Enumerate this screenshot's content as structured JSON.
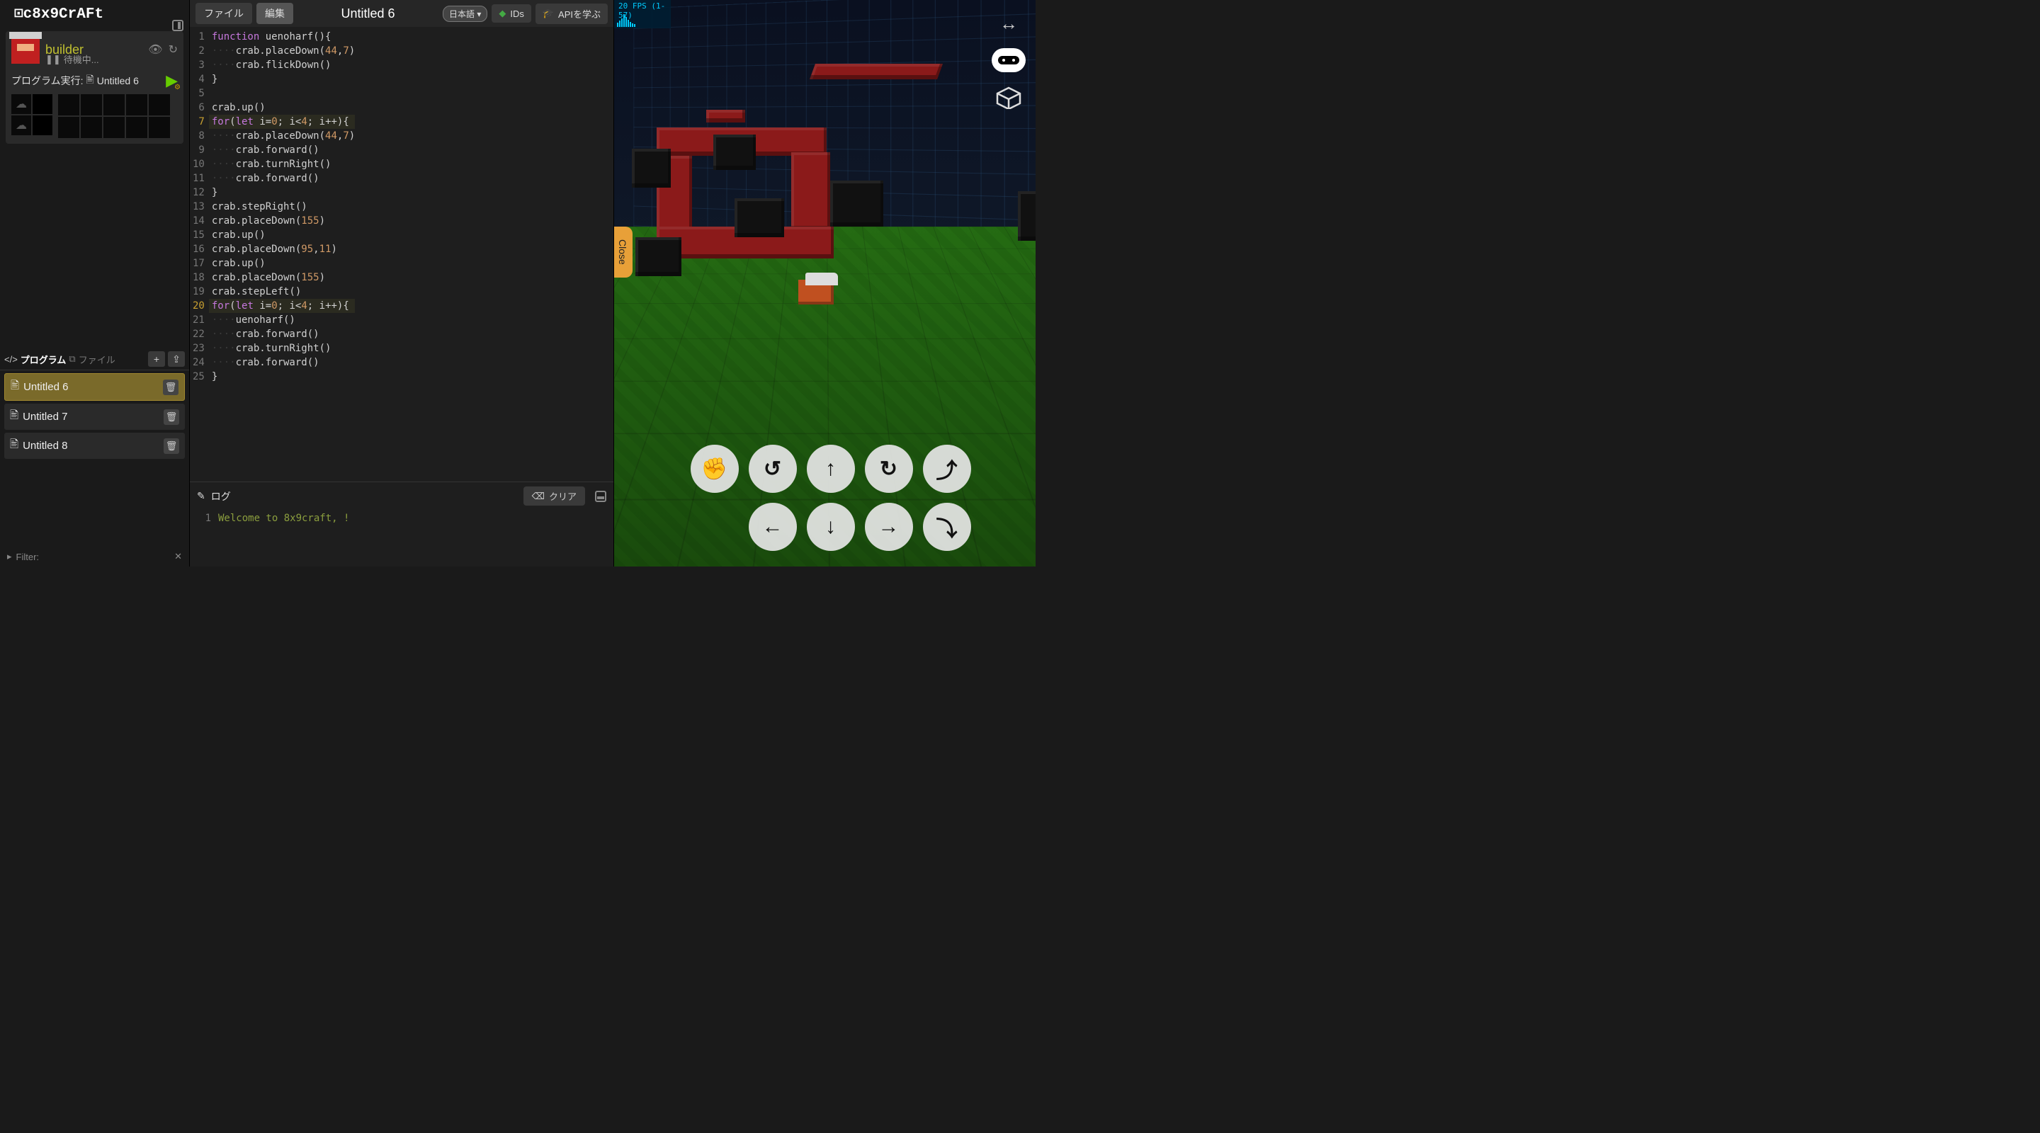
{
  "app": {
    "logo": "⊡c8x9CrAFt"
  },
  "builder": {
    "name": "builder",
    "status_icon": "❚❚",
    "status_text": "待機中...",
    "exec_label": "プログラム実行:",
    "exec_file_icon": "🖹",
    "exec_file": "Untitled 6"
  },
  "toolbar": {
    "file": "ファイル",
    "edit": "編集",
    "title": "Untitled 6",
    "lang": "日本語",
    "ids": "IDs",
    "api": "APIを学ぶ"
  },
  "code": {
    "lines": [
      {
        "n": 1,
        "html": "<span class='kw'>function</span> <span class='ident'>uenoharf</span><span class='paren'>(){</span>"
      },
      {
        "n": 2,
        "html": "<span class='whitespace'>····</span>crab.placeDown(<span class='num'>44</span>,<span class='num'>7</span>)"
      },
      {
        "n": 3,
        "html": "<span class='whitespace'>····</span>crab.flickDown()"
      },
      {
        "n": 4,
        "html": "}"
      },
      {
        "n": 5,
        "html": ""
      },
      {
        "n": 6,
        "html": "crab.up()"
      },
      {
        "n": 7,
        "hl": true,
        "html": "<span class='kw'>for</span>(<span class='decl'>let</span> i=<span class='num'>0</span>; i&lt;<span class='num'>4</span>; i++){"
      },
      {
        "n": 8,
        "html": "<span class='whitespace'>····</span>crab.placeDown(<span class='num'>44</span>,<span class='num'>7</span>)"
      },
      {
        "n": 9,
        "html": "<span class='whitespace'>····</span>crab.forward()"
      },
      {
        "n": 10,
        "html": "<span class='whitespace'>····</span>crab.turnRight()"
      },
      {
        "n": 11,
        "html": "<span class='whitespace'>····</span>crab.forward()"
      },
      {
        "n": 12,
        "html": "}"
      },
      {
        "n": 13,
        "html": "crab.stepRight()"
      },
      {
        "n": 14,
        "html": "crab.placeDown(<span class='num'>155</span>)"
      },
      {
        "n": 15,
        "html": "crab.up()"
      },
      {
        "n": 16,
        "html": "crab.placeDown(<span class='num'>95</span>,<span class='num'>11</span>)"
      },
      {
        "n": 17,
        "html": "crab.up()"
      },
      {
        "n": 18,
        "html": "crab.placeDown(<span class='num'>155</span>)"
      },
      {
        "n": 19,
        "html": "crab.stepLeft()"
      },
      {
        "n": 20,
        "hl": true,
        "html": "<span class='kw'>for</span>(<span class='decl'>let</span> i=<span class='num'>0</span>; i&lt;<span class='num'>4</span>; i++){"
      },
      {
        "n": 21,
        "html": "<span class='whitespace'>····</span>uenoharf()"
      },
      {
        "n": 22,
        "html": "<span class='whitespace'>····</span>crab.forward()"
      },
      {
        "n": 23,
        "html": "<span class='whitespace'>····</span>crab.turnRight()"
      },
      {
        "n": 24,
        "html": "<span class='whitespace'>····</span>crab.forward()"
      },
      {
        "n": 25,
        "html": "}"
      }
    ]
  },
  "tabs": {
    "program": "プログラム",
    "file": "ファイル"
  },
  "programs": [
    {
      "name": "Untitled 6",
      "selected": true
    },
    {
      "name": "Untitled 7",
      "selected": false
    },
    {
      "name": "Untitled 8",
      "selected": false
    }
  ],
  "filter": {
    "label": "Filter:",
    "close": "✕"
  },
  "log": {
    "title": "ログ",
    "clear": "クリア",
    "lines": [
      {
        "n": 1,
        "text": "Welcome to 8x9craft, !"
      }
    ]
  },
  "viewport": {
    "fps": "20 FPS (1-57)",
    "close_tab": "Close"
  },
  "dpad": {
    "grab": "✊",
    "undo": "↺",
    "up": "↑",
    "redo": "↻",
    "jump_up": "⤴",
    "left": "←",
    "down": "↓",
    "right": "→",
    "jump_down": "⤵"
  }
}
